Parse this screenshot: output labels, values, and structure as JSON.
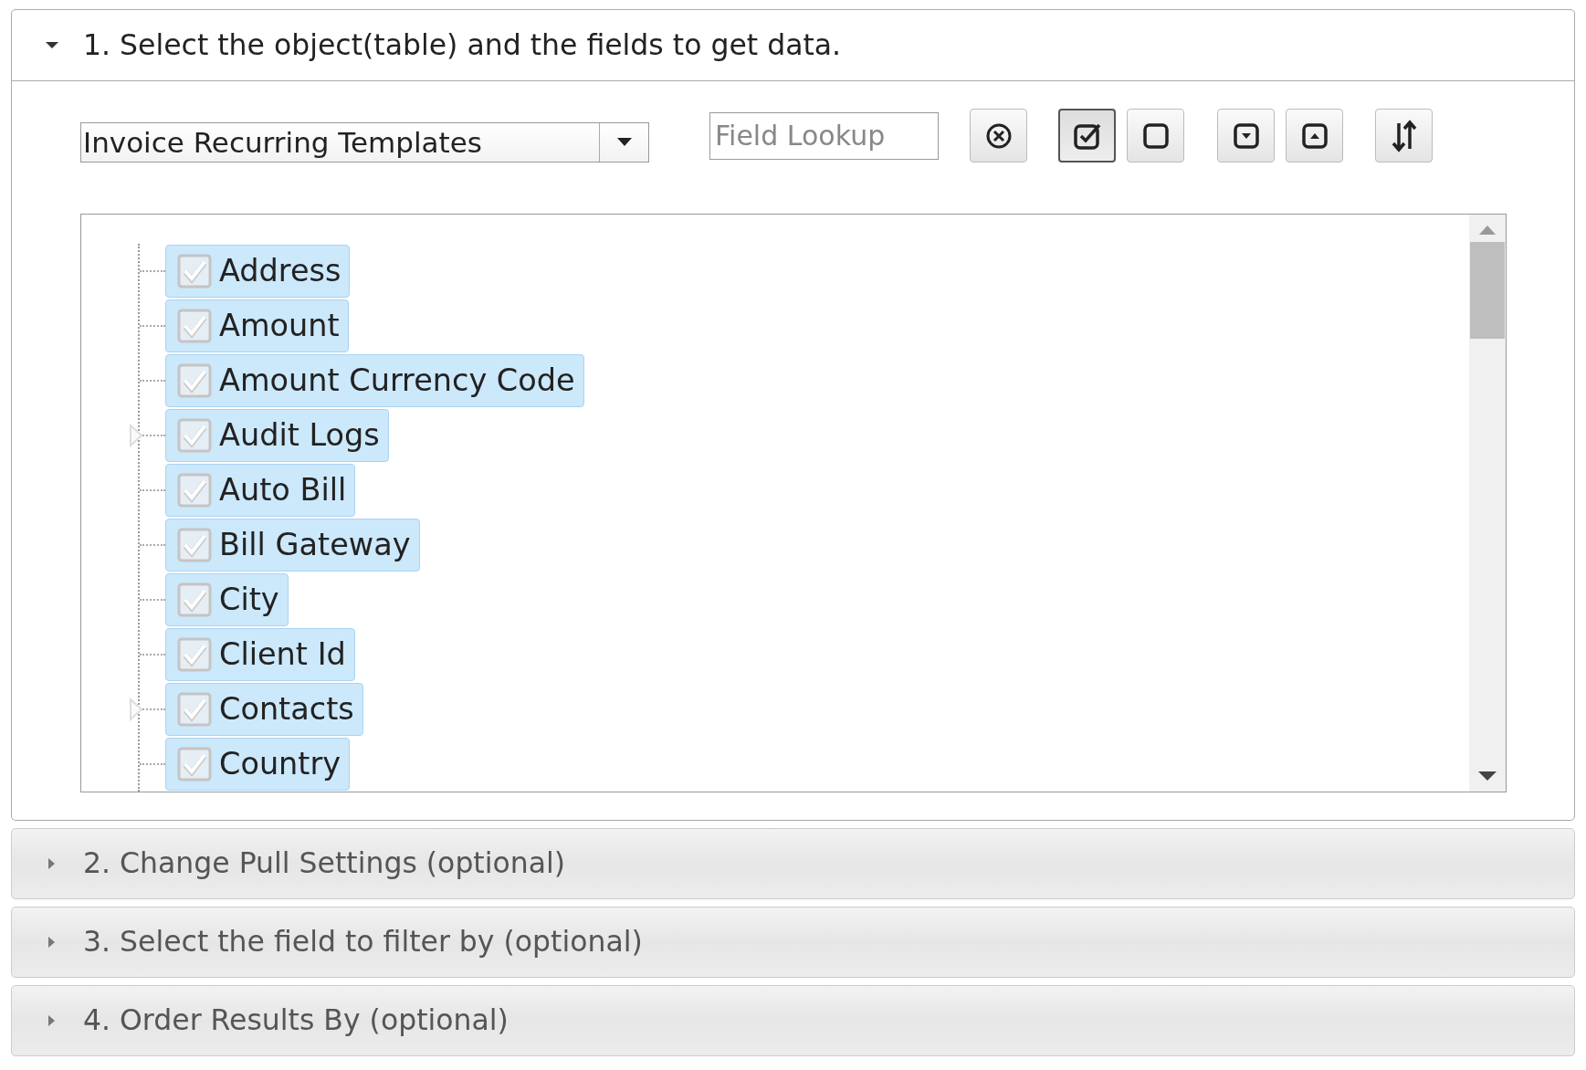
{
  "panels": [
    {
      "title": "1. Select the object(table) and the fields to get data.",
      "expanded": true
    },
    {
      "title": "2. Change Pull Settings (optional)",
      "expanded": false
    },
    {
      "title": "3. Select the field to filter by (optional)",
      "expanded": false
    },
    {
      "title": "4. Order Results By (optional)",
      "expanded": false
    }
  ],
  "object_select": {
    "value": "Invoice Recurring Templates"
  },
  "field_lookup": {
    "placeholder": "Field Lookup"
  },
  "toolbar_buttons": [
    {
      "kind": "clear",
      "pressed": false
    },
    {
      "kind": "check-all",
      "pressed": true
    },
    {
      "kind": "uncheck-all",
      "pressed": false
    },
    {
      "kind": "expand",
      "pressed": false
    },
    {
      "kind": "collapse",
      "pressed": false
    },
    {
      "kind": "sort",
      "pressed": false
    }
  ],
  "fields": [
    {
      "label": "Address",
      "checked": true,
      "expandable": false
    },
    {
      "label": "Amount",
      "checked": true,
      "expandable": false
    },
    {
      "label": "Amount Currency Code",
      "checked": true,
      "expandable": false
    },
    {
      "label": "Audit Logs",
      "checked": true,
      "expandable": true
    },
    {
      "label": "Auto Bill",
      "checked": true,
      "expandable": false
    },
    {
      "label": "Bill Gateway",
      "checked": true,
      "expandable": false
    },
    {
      "label": "City",
      "checked": true,
      "expandable": false
    },
    {
      "label": "Client Id",
      "checked": true,
      "expandable": false
    },
    {
      "label": "Contacts",
      "checked": true,
      "expandable": true
    },
    {
      "label": "Country",
      "checked": true,
      "expandable": false
    }
  ]
}
